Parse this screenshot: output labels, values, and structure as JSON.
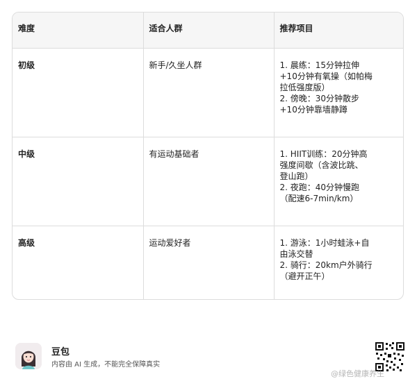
{
  "table": {
    "headers": [
      "难度",
      "适合人群",
      "推荐项目"
    ],
    "rows": [
      {
        "level": "初级",
        "audience": "新手/久坐人群",
        "items": [
          "1. 晨练：15分钟拉伸",
          "+10分钟有氧操（如帕梅",
          "拉低强度版）",
          "2. 傍晚：30分钟散步",
          "+10分钟靠墙静蹲"
        ]
      },
      {
        "level": "中级",
        "audience": "有运动基础者",
        "items": [
          "1. HIIT训练：20分钟高",
          "强度间歇（含波比跳、",
          "登山跑）",
          "2. 夜跑：40分钟慢跑",
          "（配速6-7min/km）"
        ]
      },
      {
        "level": "高级",
        "audience": "运动爱好者",
        "items": [
          "1. 游泳：1小时蛙泳+自",
          "由泳交替",
          "2. 骑行：20km户外骑行",
          "（避开正午）"
        ]
      }
    ]
  },
  "footer": {
    "brand": "豆包",
    "disclaimer": "内容由 AI 生成，不能完全保障真实",
    "avatar_icon": "avatar-girl-icon",
    "qr_icon": "qr-code-icon"
  },
  "watermark": "@绿色健康养生"
}
